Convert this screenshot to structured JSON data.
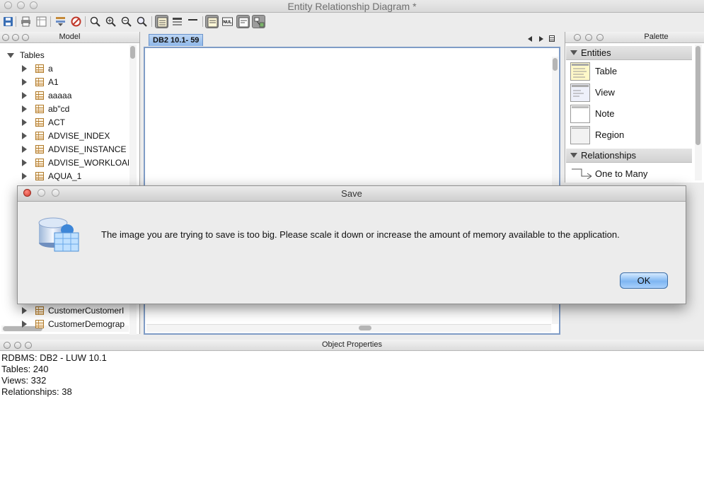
{
  "window": {
    "title": "Entity Relationship Diagram *"
  },
  "model_panel": {
    "title": "Model",
    "root": "Tables",
    "items": [
      "a",
      "A1",
      "aaaaa",
      "ab\"cd",
      "ACT",
      "ADVISE_INDEX",
      "ADVISE_INSTANCE",
      "ADVISE_WORKLOAD",
      "AQUA_1"
    ],
    "lower_items": [
      "CustomerCustomerI",
      "CustomerDemograp"
    ]
  },
  "editor": {
    "tab_label": "DB2 10.1- 59"
  },
  "palette": {
    "title": "Palette",
    "sections": [
      {
        "label": "Entities",
        "items": [
          "Table",
          "View",
          "Note",
          "Region"
        ]
      },
      {
        "label": "Relationships",
        "items": [
          "One to Many"
        ]
      }
    ]
  },
  "properties": {
    "title": "Object Properties",
    "lines": [
      "RDBMS: DB2 - LUW 10.1",
      "Tables: 240",
      "Views: 332",
      "Relationships: 38"
    ]
  },
  "dialog": {
    "title": "Save",
    "message": "The image you are trying to save is too big.  Please scale it down or increase the amount of memory available to the application.",
    "ok_label": "OK",
    "icon": "database-image-icon"
  },
  "colors": {
    "accent": "#7fb6f2",
    "tab": "#9fc3ee",
    "close_button": "#d0392b"
  }
}
